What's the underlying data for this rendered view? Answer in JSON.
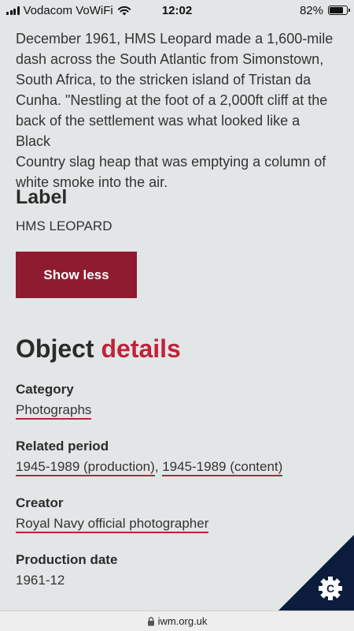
{
  "status_bar": {
    "carrier": "Vodacom VoWiFi",
    "time": "12:02",
    "battery": "82%",
    "battery_level": 0.82
  },
  "article": {
    "paragraph_lines": [
      "December 1961, HMS Leopard made a 1,600-mile",
      "dash across the South Atlantic from Simonstown,",
      "South Africa, to the stricken island of Tristan da",
      "Cunha. \"Nestling at the foot of a 2,000ft cliff at the",
      "back of the settlement was what looked like a Black",
      "Country slag heap that was emptying a column of",
      "white smoke into the air."
    ],
    "label_heading": "Label",
    "label_value": "HMS LEOPARD",
    "show_less": "Show less"
  },
  "object_details": {
    "heading_plain": "Object",
    "heading_accent": "details",
    "accent_color": "#c0223a",
    "category_label": "Category",
    "category_value": "Photographs",
    "related_period_label": "Related period",
    "related_period_1": "1945-1989 (production)",
    "related_period_sep": ",",
    "related_period_2": "1945-1989 (content)",
    "creator_label": "Creator",
    "creator_value": "Royal Navy official photographer",
    "production_date_label": "Production date",
    "production_date_value": "1961-12"
  },
  "cookie_badge": {
    "icon": "cookie-settings-icon",
    "letter": "C"
  },
  "address_bar": {
    "domain": "iwm.org.uk",
    "icon": "lock-icon"
  },
  "colors": {
    "button": "#8e1b2f",
    "background": "#e3e6e7",
    "badge": "#0b1c3d"
  }
}
